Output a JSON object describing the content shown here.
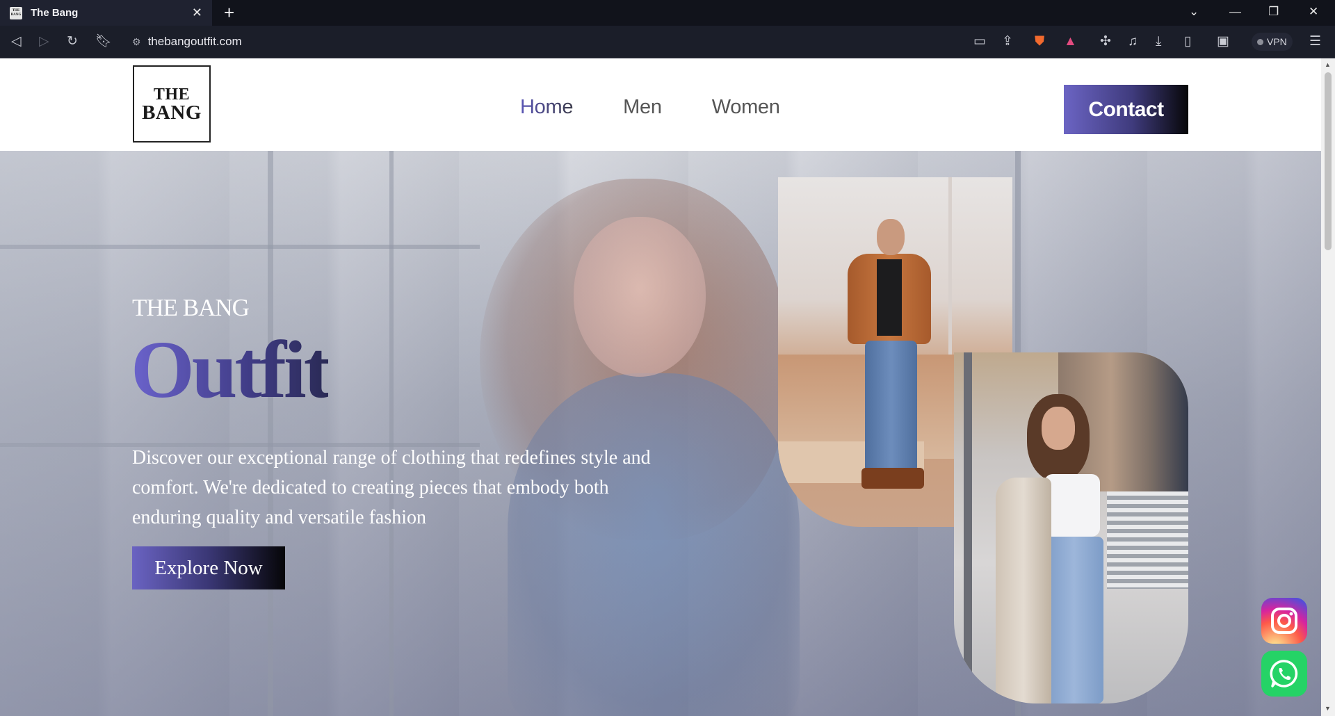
{
  "browser": {
    "tab_title": "The Bang",
    "tab_favicon_text": "THE BANG",
    "url": "thebangoutfit.com",
    "vpn_label": "VPN",
    "icons": {
      "back": "back-arrow-icon",
      "forward": "forward-arrow-icon",
      "reload": "reload-icon",
      "bookmark": "bookmark-icon",
      "site_info": "site-info-icon",
      "cast": "cast-icon",
      "share": "share-icon",
      "brave": "brave-shield-icon",
      "rewards": "brave-rewards-icon",
      "extensions": "puzzle-icon",
      "media": "music-note-icon",
      "downloads": "download-icon",
      "sidebar": "sidebar-icon",
      "wallet": "wallet-icon",
      "menu": "hamburger-menu-icon"
    }
  },
  "site": {
    "logo_line1": "THE",
    "logo_line2": "BANG",
    "nav": [
      {
        "label": "Home",
        "active": true
      },
      {
        "label": "Men",
        "active": false
      },
      {
        "label": "Women",
        "active": false
      }
    ],
    "contact_label": "Contact"
  },
  "hero": {
    "kicker": "THE BANG",
    "title": "Outfit",
    "description": "Discover our exceptional range of clothing that redefines style and comfort. We're dedicated to creating pieces that embody both enduring quality and versatile fashion",
    "cta_label": "Explore Now"
  },
  "social": {
    "instagram": "instagram-icon",
    "whatsapp": "whatsapp-icon"
  },
  "colors": {
    "accent_start": "#6b64c3",
    "accent_end": "#070709",
    "whatsapp": "#25d366"
  }
}
